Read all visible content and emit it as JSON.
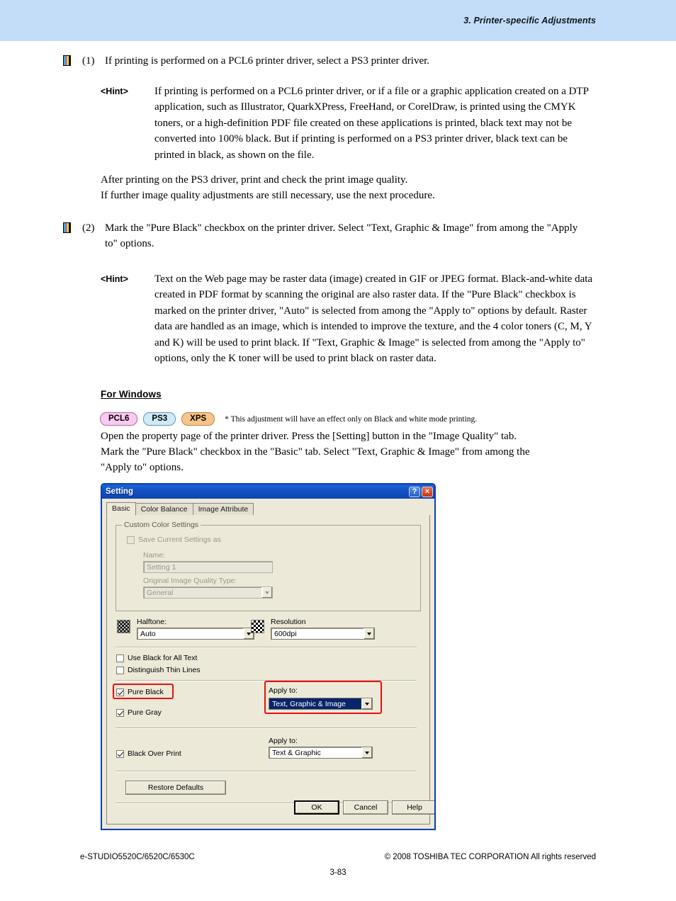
{
  "header": {
    "chapter_title": "3. Printer-specific Adjustments"
  },
  "steps": [
    {
      "number": "(1)",
      "text": "If printing is performed on a PCL6 printer driver, select a PS3 printer driver.",
      "hint_label": "<Hint>",
      "hint_text": "If printing is performed on a PCL6 printer driver, or if a file or a graphic application created on a DTP application, such as Illustrator, QuarkXPress, FreeHand, or CorelDraw, is printed using the CMYK toners, or a high-definition PDF file created on these applications is printed, black text may not be converted into 100% black.  But if printing is performed on a PS3 printer driver, black text can be printed in black, as shown on the file."
    },
    {
      "number": "(2)",
      "text": "Mark the \"Pure Black\" checkbox on the printer driver.  Select \"Text, Graphic & Image\" from among the \"Apply to\" options.",
      "hint_label": "<Hint>",
      "hint_text": "Text on the Web page may be raster data (image) created in GIF or JPEG format.  Black-and-white data created in PDF format by scanning the original are also raster data.  If the \"Pure Black\" checkbox is marked on the printer driver, \"Auto\" is selected from among the \"Apply to\" options by default.  Raster data are handled as an image, which is intended to improve the texture, and the 4 color toners (C, M, Y and K) will be used to print black.  If \"Text, Graphic & Image\" is selected from among the \"Apply to\" options, only the K toner will be used to print black on raster data."
    }
  ],
  "after_step1": {
    "line1": "After printing on the PS3 driver, print and check the print image quality.",
    "line2": "If further image quality adjustments are still necessary, use the next procedure."
  },
  "for_windows": {
    "heading": "For Windows",
    "badges": [
      {
        "label": "PCL6",
        "color": "#f9c9ef"
      },
      {
        "label": "PS3",
        "color": "#cfeaf8"
      },
      {
        "label": "XPS",
        "color": "#f9c48a"
      }
    ],
    "badge_note": "* This adjustment will have an effect only on Black and white mode printing.",
    "line1": "Open the property page of the printer driver.  Press the [Setting] button in the \"Image Quality\" tab.",
    "line2": "Mark the \"Pure Black\" checkbox in the \"Basic\" tab.  Select \"Text, Graphic & Image\" from among the",
    "line3": "\"Apply to\" options."
  },
  "dialog": {
    "title": "Setting",
    "help_button": "?",
    "close_button": "×",
    "tabs": [
      {
        "label": "Basic",
        "active": true
      },
      {
        "label": "Color Balance",
        "active": false
      },
      {
        "label": "Image Attribute",
        "active": false
      }
    ],
    "custom_color_settings": {
      "group_title": "Custom Color Settings",
      "save_current_checkbox": "Save Current Settings as",
      "save_current_checked": false,
      "name_label": "Name:",
      "name_value": "Setting 1",
      "quality_type_label": "Original Image Quality Type:",
      "quality_type_value": "General"
    },
    "halftone": {
      "label": "Halftone:",
      "value": "Auto",
      "icon": "halftone-dither-icon"
    },
    "resolution": {
      "label": "Resolution",
      "value": "600dpi",
      "icon": "resolution-checker-icon"
    },
    "checkboxes": {
      "use_black_for_all_text": "Use Black for All Text",
      "use_black_for_all_text_checked": false,
      "distinguish_thin_lines": "Distinguish Thin Lines",
      "distinguish_thin_lines_checked": false,
      "pure_black": "Pure Black",
      "pure_black_checked": true,
      "pure_gray": "Pure Gray",
      "pure_gray_checked": true,
      "black_over_print": "Black Over Print",
      "black_over_print_checked": true
    },
    "pure_black_apply_to": {
      "label": "Apply to:",
      "value": "Text, Graphic & Image"
    },
    "black_over_print_apply_to": {
      "label": "Apply to:",
      "value": "Text & Graphic"
    },
    "restore_defaults": "Restore Defaults",
    "buttons": {
      "ok": "OK",
      "cancel": "Cancel",
      "help": "Help"
    },
    "highlight_color": "#e8110c"
  },
  "footer": {
    "model": "e-STUDIO5520C/6520C/6530C",
    "copyright": "© 2008 TOSHIBA TEC CORPORATION All rights reserved",
    "page": "3-83"
  }
}
